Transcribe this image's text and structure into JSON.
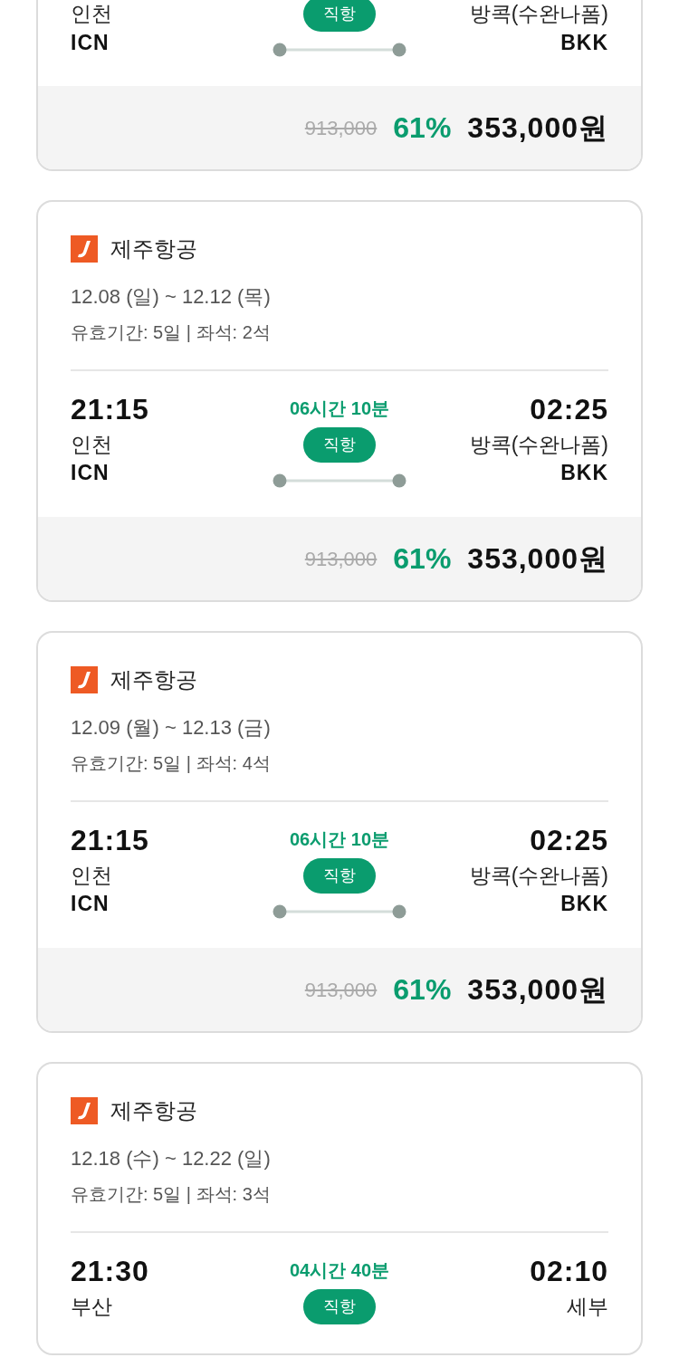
{
  "flights": [
    {
      "origin_city": "인천",
      "origin_code": "ICN",
      "badge": "직항",
      "dest_city": "방콕(수완나폼)",
      "dest_code": "BKK",
      "original_price": "913,000",
      "discount": "61%",
      "price": "353,000원"
    },
    {
      "airline": "제주항공",
      "dates": "12.08 (일) ~ 12.12 (목)",
      "validity": "유효기간: 5일 | 좌석: 2석",
      "depart_time": "21:15",
      "duration": "06시간 10분",
      "arrive_time": "02:25",
      "origin_city": "인천",
      "origin_code": "ICN",
      "badge": "직항",
      "dest_city": "방콕(수완나폼)",
      "dest_code": "BKK",
      "original_price": "913,000",
      "discount": "61%",
      "price": "353,000원"
    },
    {
      "airline": "제주항공",
      "dates": "12.09 (월) ~ 12.13 (금)",
      "validity": "유효기간: 5일 | 좌석: 4석",
      "depart_time": "21:15",
      "duration": "06시간 10분",
      "arrive_time": "02:25",
      "origin_city": "인천",
      "origin_code": "ICN",
      "badge": "직항",
      "dest_city": "방콕(수완나폼)",
      "dest_code": "BKK",
      "original_price": "913,000",
      "discount": "61%",
      "price": "353,000원"
    },
    {
      "airline": "제주항공",
      "dates": "12.18 (수) ~ 12.22 (일)",
      "validity": "유효기간: 5일 | 좌석: 3석",
      "depart_time": "21:30",
      "duration": "04시간 40분",
      "arrive_time": "02:10",
      "origin_city": "부산",
      "badge": "직항",
      "dest_city": "세부"
    }
  ]
}
